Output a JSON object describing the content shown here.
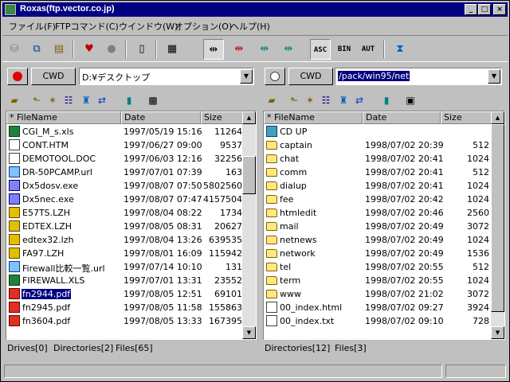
{
  "window": {
    "title": "Roxas(ftp.vector.co.jp)"
  },
  "menu": [
    "ファイル(F)",
    "FTPコマンド(C)",
    "ウインドウ(W)",
    "オプション(O)",
    "ヘルプ(H)"
  ],
  "toolbar": {
    "ascii_label": "ASC",
    "binary_label": "BIN",
    "auto_label": "AUT"
  },
  "left": {
    "cwd_label": "CWD",
    "path": "D:¥デスクトップ",
    "headers": {
      "name": "* FileName",
      "date": "Date",
      "size": "Size"
    },
    "files": [
      {
        "name": "CGI_M_s.xls",
        "date": "1997/05/19 15:16",
        "size": "11264",
        "icon": "xls-file-icon"
      },
      {
        "name": "CONT.HTM",
        "date": "1997/06/27 09:00",
        "size": "9537",
        "icon": "html-file-icon"
      },
      {
        "name": "DEMOTOOL.DOC",
        "date": "1997/06/03 12:16",
        "size": "32256",
        "icon": "doc-file-icon"
      },
      {
        "name": "DR-50PCAMP.url",
        "date": "1997/07/01 07:39",
        "size": "163",
        "icon": "url-file-icon"
      },
      {
        "name": "Dx5dosv.exe",
        "date": "1997/08/07 07:50",
        "size": "5802560",
        "icon": "exe-file-icon"
      },
      {
        "name": "Dx5nec.exe",
        "date": "1997/08/07 07:47",
        "size": "4157504",
        "icon": "exe-file-icon"
      },
      {
        "name": "E57TS.LZH",
        "date": "1997/08/04 08:22",
        "size": "1734",
        "icon": "lzh-file-icon"
      },
      {
        "name": "EDTEX.LZH",
        "date": "1997/08/05 08:31",
        "size": "20627",
        "icon": "lzh-file-icon"
      },
      {
        "name": "edtex32.lzh",
        "date": "1997/08/04 13:26",
        "size": "639535",
        "icon": "lzh-file-icon"
      },
      {
        "name": "FA97.LZH",
        "date": "1997/08/01 16:09",
        "size": "115942",
        "icon": "lzh-file-icon"
      },
      {
        "name": "Firewall比較一覧.url",
        "date": "1997/07/14 10:10",
        "size": "131",
        "icon": "url-file-icon"
      },
      {
        "name": "FIREWALL.XLS",
        "date": "1997/07/01 13:31",
        "size": "23552",
        "icon": "xls-file-icon"
      },
      {
        "name": "fn2944.pdf",
        "date": "1997/08/05 12:51",
        "size": "69101",
        "icon": "pdf-file-icon",
        "selected": true
      },
      {
        "name": "fn2945.pdf",
        "date": "1997/08/05 11:58",
        "size": "155863",
        "icon": "pdf-file-icon"
      },
      {
        "name": "fn3604.pdf",
        "date": "1997/08/05 13:33",
        "size": "167395",
        "icon": "pdf-file-icon"
      }
    ],
    "status": {
      "drives": "Drives[0]",
      "dirs": "Directories[2]",
      "files": "Files[65]"
    }
  },
  "right": {
    "cwd_label": "CWD",
    "path": "/pack/win95/net",
    "headers": {
      "name": "* FileName",
      "date": "Date",
      "size": "Size"
    },
    "files": [
      {
        "name": "CD UP",
        "date": "",
        "size": "",
        "icon": "cd-up-icon"
      },
      {
        "name": "captain",
        "date": "1998/07/02 20:39",
        "size": "512",
        "icon": "folder-icon"
      },
      {
        "name": "chat",
        "date": "1998/07/02 20:41",
        "size": "1024",
        "icon": "folder-icon"
      },
      {
        "name": "comm",
        "date": "1998/07/02 20:41",
        "size": "512",
        "icon": "folder-icon"
      },
      {
        "name": "dialup",
        "date": "1998/07/02 20:41",
        "size": "1024",
        "icon": "folder-icon"
      },
      {
        "name": "fee",
        "date": "1998/07/02 20:42",
        "size": "1024",
        "icon": "folder-icon"
      },
      {
        "name": "htmledit",
        "date": "1998/07/02 20:46",
        "size": "2560",
        "icon": "folder-icon"
      },
      {
        "name": "mail",
        "date": "1998/07/02 20:49",
        "size": "3072",
        "icon": "folder-icon"
      },
      {
        "name": "netnews",
        "date": "1998/07/02 20:49",
        "size": "1024",
        "icon": "folder-icon"
      },
      {
        "name": "network",
        "date": "1998/07/02 20:49",
        "size": "1536",
        "icon": "folder-icon"
      },
      {
        "name": "tel",
        "date": "1998/07/02 20:55",
        "size": "512",
        "icon": "folder-icon"
      },
      {
        "name": "term",
        "date": "1998/07/02 20:55",
        "size": "1024",
        "icon": "folder-icon"
      },
      {
        "name": "www",
        "date": "1998/07/02 21:02",
        "size": "3072",
        "icon": "folder-icon"
      },
      {
        "name": "00_index.html",
        "date": "1998/07/02 09:27",
        "size": "3924",
        "icon": "html-file-icon"
      },
      {
        "name": "00_index.txt",
        "date": "1998/07/02 09:10",
        "size": "728",
        "icon": "text-file-icon"
      }
    ],
    "status": {
      "dirs": "Directories[12]",
      "files": "Files[3]"
    }
  },
  "colors": {
    "titlebar": "#000080",
    "selection": "#000080",
    "face": "#c0c0c0",
    "record": "#e00000"
  }
}
